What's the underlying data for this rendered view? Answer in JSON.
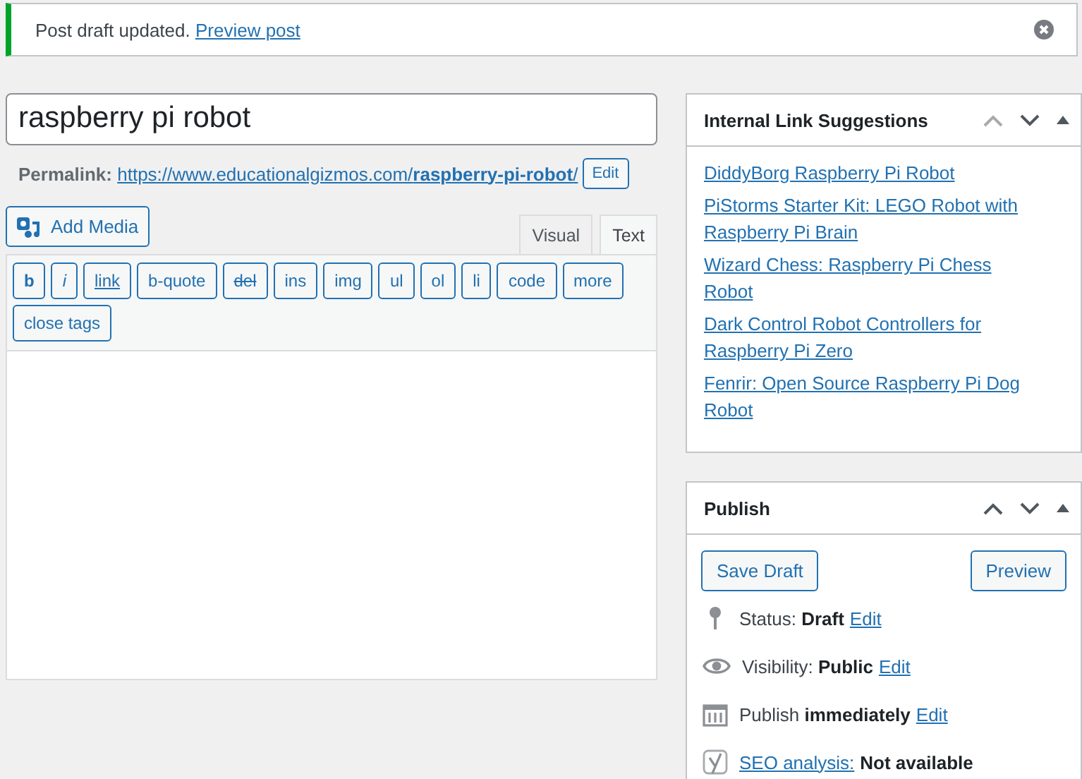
{
  "notice": {
    "message": "Post draft updated.",
    "link": "Preview post"
  },
  "title_field": {
    "value": "raspberry pi robot"
  },
  "permalink": {
    "label": "Permalink:",
    "url_base": "https://www.educationalgizmos.com/",
    "slug": "raspberry-pi-robot",
    "url_end": "/",
    "button": "Edit"
  },
  "add_media": "Add Media",
  "editor_tabs": [
    {
      "label": "Visual",
      "selected": false
    },
    {
      "label": "Text",
      "selected": true
    }
  ],
  "quicktags": [
    {
      "label": "b",
      "kind": "bold"
    },
    {
      "label": "i",
      "kind": "italic"
    },
    {
      "label": "link",
      "kind": "underline"
    },
    {
      "label": "b-quote",
      "kind": "plain"
    },
    {
      "label": "del",
      "kind": "strike"
    },
    {
      "label": "ins",
      "kind": "plain"
    },
    {
      "label": "img",
      "kind": "plain"
    },
    {
      "label": "ul",
      "kind": "plain"
    },
    {
      "label": "ol",
      "kind": "plain"
    },
    {
      "label": "li",
      "kind": "plain"
    },
    {
      "label": "code",
      "kind": "plain"
    },
    {
      "label": "more",
      "kind": "plain"
    },
    {
      "label": "close tags",
      "kind": "plain"
    }
  ],
  "link_suggestions": {
    "title": "Internal Link Suggestions",
    "links": [
      "DiddyBorg Raspberry Pi Robot",
      "PiStorms Starter Kit: LEGO Robot with Raspberry Pi Brain",
      "Wizard Chess: Raspberry Pi Chess Robot",
      "Dark Control Robot Controllers for Raspberry Pi Zero",
      "Fenrir: Open Source Raspberry Pi Dog Robot"
    ]
  },
  "publish": {
    "title": "Publish",
    "save_button": "Save Draft",
    "preview_button": "Preview",
    "rows": [
      {
        "kind": "pin",
        "text": "Status: **Draft**",
        "link_after": "Edit"
      },
      {
        "kind": "eye",
        "text": "Visibility: **Public**",
        "link_after": "Edit"
      },
      {
        "kind": "calendar",
        "text": "Publish **immediately**",
        "link_after": "Edit"
      },
      {
        "kind": "seo",
        "link_before": "SEO analysis:",
        "text": "**Not available**"
      }
    ]
  }
}
